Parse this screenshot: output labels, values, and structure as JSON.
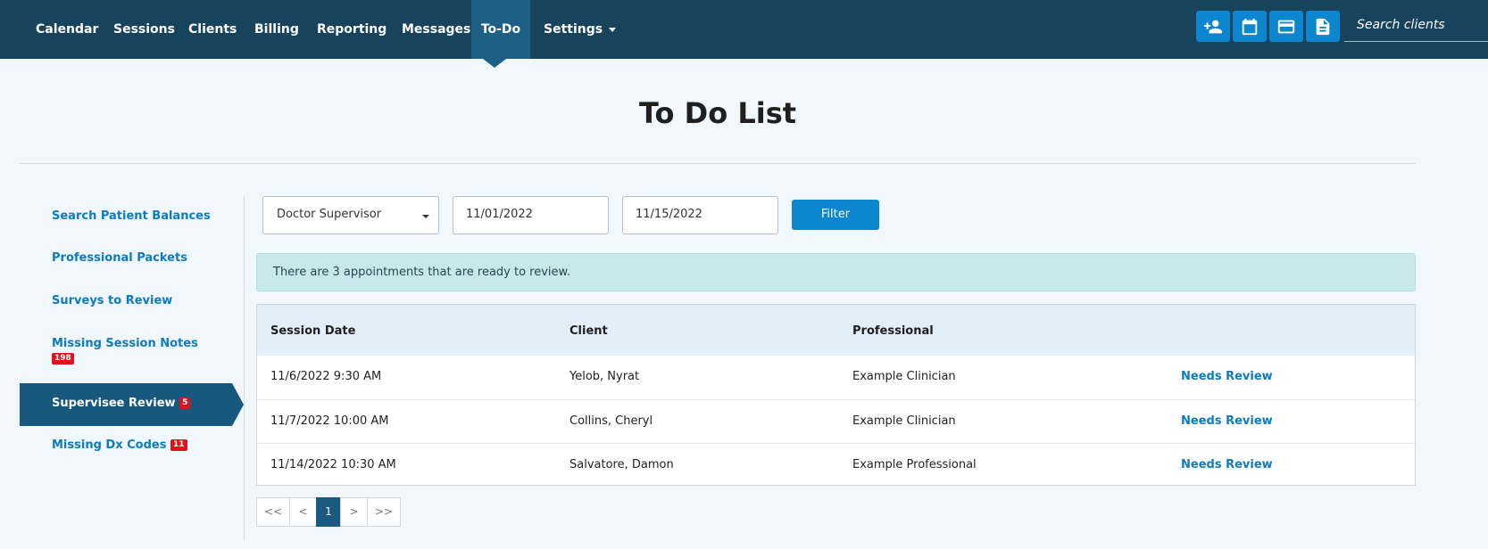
{
  "nav": {
    "items": [
      {
        "label": "Calendar"
      },
      {
        "label": "Sessions"
      },
      {
        "label": "Clients"
      },
      {
        "label": "Billing"
      },
      {
        "label": "Reporting"
      },
      {
        "label": "Messages"
      },
      {
        "label": "To-Do"
      },
      {
        "label": "Settings"
      }
    ],
    "active": "To-Do",
    "tools": [
      {
        "icon": "add-person-icon"
      },
      {
        "icon": "calendar-icon"
      },
      {
        "icon": "credit-card-icon"
      },
      {
        "icon": "document-icon"
      }
    ],
    "search_placeholder": "Search clients"
  },
  "page": {
    "title": "To Do List"
  },
  "sidebar": {
    "items": [
      {
        "label": "Search Patient Balances"
      },
      {
        "label": "Professional Packets"
      },
      {
        "label": "Surveys to Review"
      },
      {
        "label": "Missing Session Notes",
        "badge": "198"
      },
      {
        "label": "Supervisee Review",
        "badge": "5",
        "active": true
      },
      {
        "label": "Missing Dx Codes",
        "badge": "11"
      }
    ]
  },
  "filters": {
    "professional": "Doctor Supervisor",
    "start_date": "11/01/2022",
    "end_date": "11/15/2022",
    "button": "Filter"
  },
  "alert": {
    "message": "There are 3 appointments that are ready to review."
  },
  "table": {
    "columns": [
      "Session Date",
      "Client",
      "Professional"
    ],
    "rows": [
      {
        "date": "11/6/2022 9:30 AM",
        "client": "Yelob, Nyrat",
        "professional": "Example Clinician",
        "action": "Needs Review"
      },
      {
        "date": "11/7/2022 10:00 AM",
        "client": "Collins, Cheryl",
        "professional": "Example Clinician",
        "action": "Needs Review"
      },
      {
        "date": "11/14/2022 10:30 AM",
        "client": "Salvatore, Damon",
        "professional": "Example Professional",
        "action": "Needs Review"
      }
    ]
  },
  "pagination": {
    "first": "<<",
    "prev": "<",
    "current": "1",
    "next": ">",
    "last": ">>"
  },
  "colors": {
    "nav_bg": "#18435d",
    "accent": "#0c86cf",
    "link": "#0c7bc2",
    "badge": "#e2111c"
  }
}
